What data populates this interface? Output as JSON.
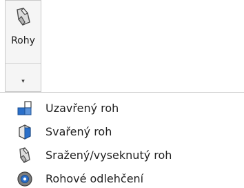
{
  "ribbon": {
    "button": {
      "label": "Rohy",
      "icon": "corner-break-icon",
      "dropdown_arrow": "▾"
    }
  },
  "menu": {
    "items": [
      {
        "label": "Uzavřený roh",
        "icon": "closed-corner-icon"
      },
      {
        "label": "Svařený roh",
        "icon": "welded-corner-icon"
      },
      {
        "label": "Sražený/vyseknutý roh",
        "icon": "break-corner-icon"
      },
      {
        "label": "Rohové odlehčení",
        "icon": "corner-relief-icon"
      }
    ]
  },
  "colors": {
    "accent_blue": "#2a6fc9",
    "icon_gray": "#7d7d7d"
  }
}
